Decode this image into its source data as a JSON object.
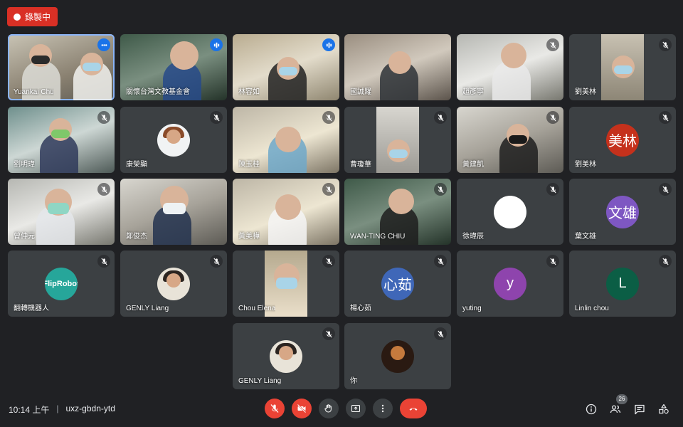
{
  "recording": {
    "label": "錄製中",
    "color": "#d93025"
  },
  "meeting": {
    "time": "10:14 上午",
    "separator": "|",
    "code": "uxz-gbdn-ytd"
  },
  "participants": [
    {
      "name": "Yuankai Chu",
      "mic": "more-icon"
    },
    {
      "name": "關懷台灣文教基金會",
      "mic": "speaking"
    },
    {
      "name": "林容如",
      "mic": "speaking"
    },
    {
      "name": "國誠羅",
      "mic": ""
    },
    {
      "name": "趙彥寧",
      "mic": "muted"
    },
    {
      "name": "劉美林",
      "mic": "muted"
    },
    {
      "name": "劉明瑋",
      "mic": "muted"
    },
    {
      "name": "康榮顯",
      "mic": "muted"
    },
    {
      "name": "陳玉桂",
      "mic": "muted"
    },
    {
      "name": "曹瓊華",
      "mic": "muted"
    },
    {
      "name": "黃建凱",
      "mic": "muted"
    },
    {
      "name": "劉美林",
      "mic": "muted",
      "avatar": "美林",
      "avatar_color": "#c5311c"
    },
    {
      "name": "曾仲元",
      "mic": "muted"
    },
    {
      "name": "鄭俊杰",
      "mic": ""
    },
    {
      "name": "黃美樺",
      "mic": "muted"
    },
    {
      "name": "WAN-TING CHIU",
      "mic": "muted"
    },
    {
      "name": "徐瑋辰",
      "mic": "muted",
      "avatar": "",
      "avatar_color": "#ffffff"
    },
    {
      "name": "葉文雄",
      "mic": "muted",
      "avatar": "文雄",
      "avatar_color": "#7e57c2"
    },
    {
      "name": "翻轉機器人",
      "mic": "muted",
      "avatar": "FlipRobot",
      "avatar_color": "#26a69a"
    },
    {
      "name": "GENLY Liang",
      "mic": "muted"
    },
    {
      "name": "Chou Elena",
      "mic": "muted"
    },
    {
      "name": "楊心茹",
      "mic": "muted",
      "avatar": "心茹",
      "avatar_color": "#3f67b8"
    },
    {
      "name": "yuting",
      "mic": "muted",
      "avatar": "y",
      "avatar_color": "#8e44ad"
    },
    {
      "name": "Linlin chou",
      "mic": "muted",
      "avatar": "L",
      "avatar_color": "#0b5e45"
    },
    {
      "name": "GENLY Liang",
      "mic": "muted"
    },
    {
      "name": "你",
      "mic": "muted"
    }
  ],
  "controls": {
    "mic": "mic-off-icon",
    "camera": "camera-off-icon",
    "raise_hand": "hand-icon",
    "present": "present-icon",
    "more": "more-vert-icon",
    "hangup": "hangup-icon"
  },
  "tools": {
    "info": "info-icon",
    "people": "people-icon",
    "people_count": "26",
    "chat": "chat-icon",
    "activities": "activities-icon"
  }
}
